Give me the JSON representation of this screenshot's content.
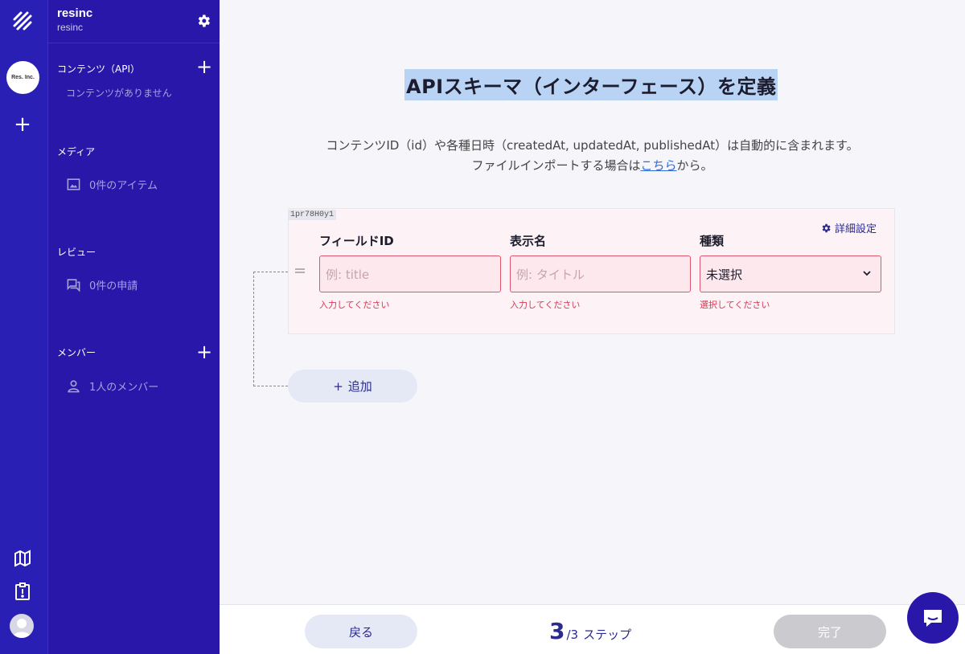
{
  "workspace": {
    "name": "resinc",
    "subname": "resinc",
    "avatar_text": "Res. Inc."
  },
  "sidebar": {
    "sections": [
      {
        "title": "コンテンツ（API）",
        "empty_text": "コンテンツがありません"
      },
      {
        "title": "メディア",
        "item": "0件のアイテム"
      },
      {
        "title": "レビュー",
        "item": "0件の申請"
      },
      {
        "title": "メンバー",
        "item": "1人のメンバー"
      }
    ]
  },
  "main": {
    "title": "APIスキーマ（インターフェース）を定義",
    "desc_line1": "コンテンツID（id）や各種日時（createdAt, updatedAt, publishedAt）は自動的に含まれます。",
    "desc_line2_pre": "ファイルインポートする場合は",
    "desc_link": "こちら",
    "desc_line2_post": "から。",
    "field": {
      "tag": "1pr78H0y1",
      "advanced_label": "詳細設定",
      "columns": [
        {
          "label": "フィールドID",
          "placeholder": "例: title",
          "error": "入力してください"
        },
        {
          "label": "表示名",
          "placeholder": "例: タイトル",
          "error": "入力してください"
        },
        {
          "label": "種類",
          "value": "未選択",
          "error": "選択してください"
        }
      ]
    },
    "add_label": "追加"
  },
  "footer": {
    "back_label": "戻る",
    "current_step": "3",
    "total_steps": "/3",
    "step_label": "ステップ",
    "done_label": "完了"
  },
  "colors": {
    "rail": "#2a1fb5",
    "sidebar": "#2817a8",
    "accent": "#2a2a8f",
    "error": "#d23a55"
  }
}
